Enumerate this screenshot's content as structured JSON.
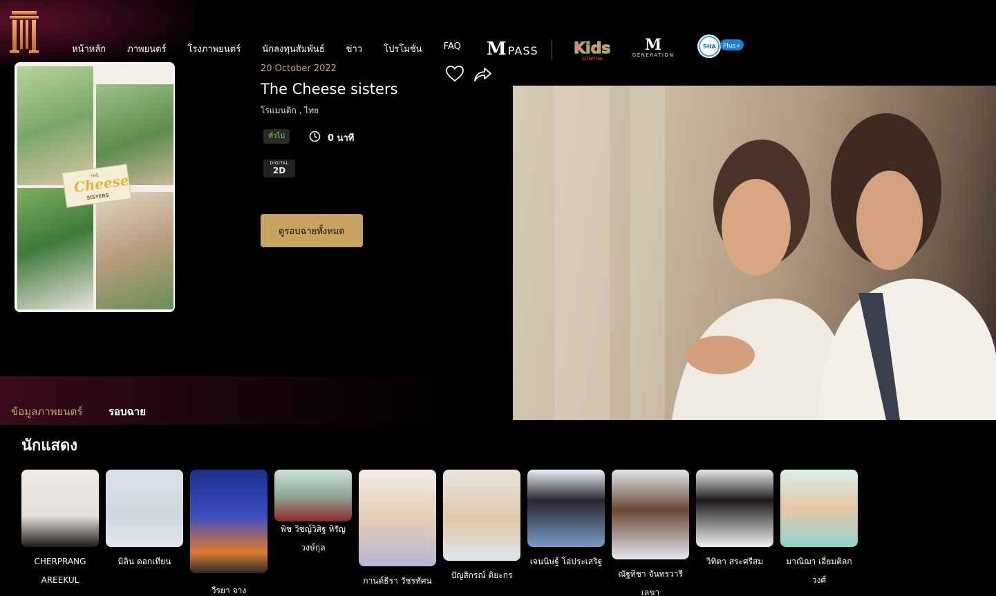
{
  "nav": {
    "items": [
      "หน้าหลัก",
      "ภาพยนตร์",
      "โรงภาพยนตร์",
      "นักลงทุนสัมพันธ์",
      "ข่าว",
      "โปรโมชั่น",
      "FAQ"
    ],
    "mpass_m": "M",
    "mpass_text": "PASS",
    "mgen_m": "M",
    "mgen_text": "GENERATION",
    "kids_text": "Kids",
    "kids_sub": "cinema",
    "sha_text": "SHA",
    "sha_plus": "Plus+"
  },
  "movie": {
    "release_date": "20 October 2022",
    "title": "The Cheese sisters",
    "genres": "โรแมนติก , ไทย",
    "rating": "ทั่วไป",
    "duration": "0 นาที",
    "format_top": "DIGITAL",
    "format_main": "2D",
    "showtimes_button": "ดูรอบฉายทั้งหมด",
    "poster_title_1": "THE",
    "poster_title_2": "Cheese",
    "poster_title_3": "SISTERS"
  },
  "tabs": {
    "info": "ข้อมูลภาพยนตร์",
    "showtimes": "รอบฉาย"
  },
  "cast": {
    "heading": "นักแสดง",
    "members": [
      {
        "name": "CHERPRANG AREEKUL"
      },
      {
        "name": "มิลิน ดอกเทียน"
      },
      {
        "name": "วีรยา จาง"
      },
      {
        "name": "พิช วิชญ์วิสิฐ หิรัญวงษ์กุล"
      },
      {
        "name": "กานต์ธีรา วัชรทัศน"
      },
      {
        "name": "ปัญสิกรณ์ ติยะกร"
      },
      {
        "name": "เจนนิษฐ์ โอ่ประเสริฐ"
      },
      {
        "name": "ณัฐทิชา จันทรวารีเลขา"
      },
      {
        "name": "วิทิตา สระศรีสม"
      },
      {
        "name": "มาณิฌา เอี่ยมติลกวงศ์"
      }
    ]
  },
  "colors": {
    "accent_gold": "#c9a362",
    "background": "#000000",
    "rating_green": "#8fd14f",
    "brand_red": "#5a0f2a"
  }
}
